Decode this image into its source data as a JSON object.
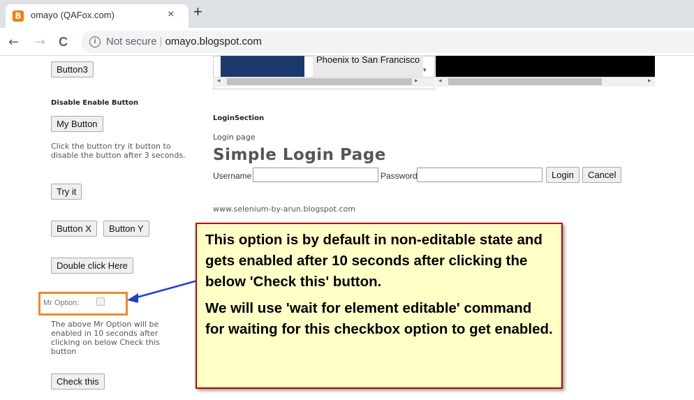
{
  "browser": {
    "tab_title": "omayo (QAFox.com)",
    "tab_close": "×",
    "new_tab": "+",
    "favicon": "B",
    "nav": {
      "back": "←",
      "forward": "→",
      "reload": "C"
    },
    "address": {
      "security": "Not secure",
      "separator": "|",
      "host": "omayo.blogspot.com",
      "info_icon": "i"
    }
  },
  "left": {
    "button3": "Button3",
    "disable_heading": "Disable Enable Button",
    "my_button": "My Button",
    "click_text": "Click the button try it button to disable the button after 3 seconds.",
    "try_it": "Try it",
    "button_x": "Button X",
    "button_y": "Button Y",
    "double_click": "Double click Here",
    "mr_option": "Mr Option:",
    "above_text": "The above Mr Option will be enabled in 10 seconds after clicking on below Check this button",
    "check_this": "Check this"
  },
  "right": {
    "select_option": "Phoenix to San Francisco",
    "login_section": "LoginSection",
    "login_page": "Login page",
    "login_heading": "Simple Login Page",
    "username_label": "Username",
    "password_label": "Password",
    "login_btn": "Login",
    "cancel_btn": "Cancel",
    "footer_link": "www.selenium-by-arun.blogspot.com"
  },
  "callout": {
    "para1": "This option is by default in non-editable state and gets enabled after 10 seconds after clicking the below 'Check this' button.",
    "para2": "We will use 'wait for element editable' command for waiting for this checkbox option to get enabled."
  },
  "colors": {
    "callout_bg": "#ffffc6",
    "callout_border": "#c00000",
    "highlight": "#f08a24",
    "arrow": "#1f3fcf"
  }
}
